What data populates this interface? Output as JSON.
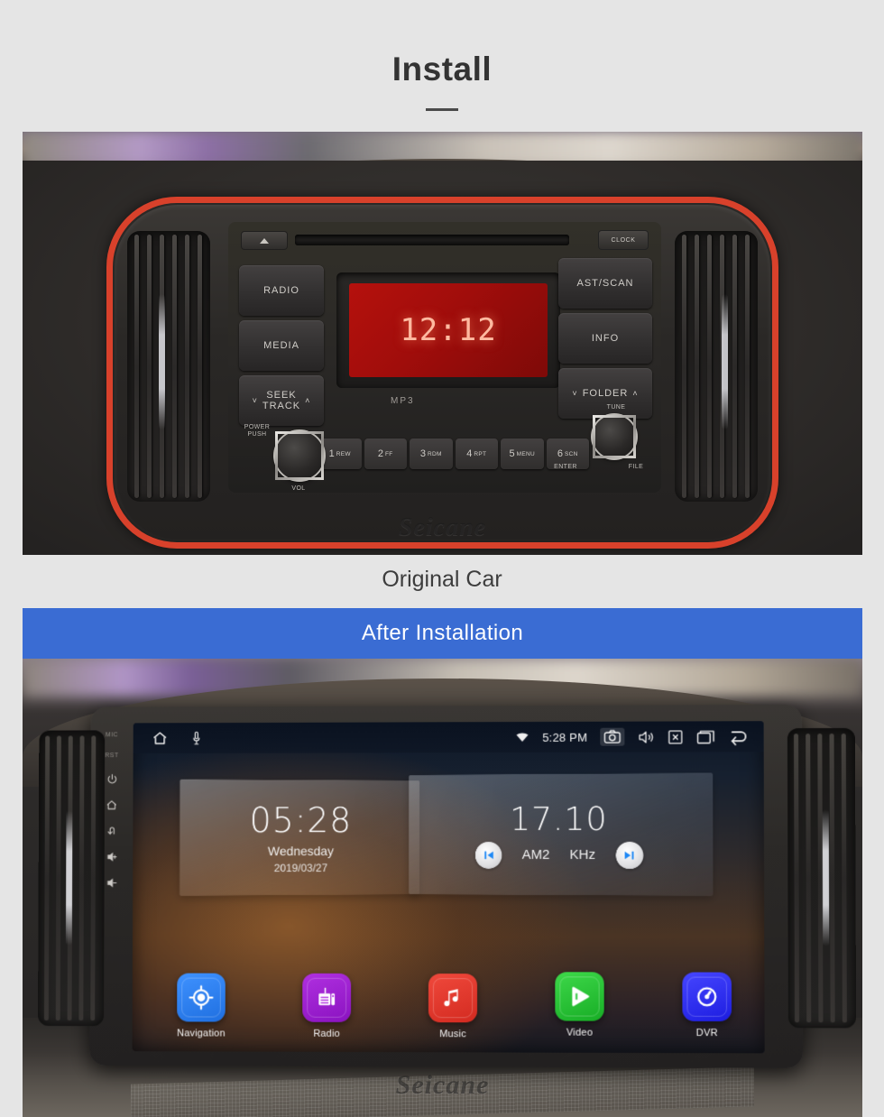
{
  "header": {
    "title": "Install"
  },
  "sections": {
    "original": {
      "caption": "Original Car",
      "watermark": "Seicane",
      "radio": {
        "display_time": "12:12",
        "format_label": "MP3",
        "clock_button": "CLOCK",
        "left_buttons": [
          {
            "label": "RADIO"
          },
          {
            "label": "MEDIA"
          },
          {
            "label_top": "SEEK",
            "label_bottom": "TRACK",
            "arrow_left": "˅",
            "arrow_right": "˄"
          }
        ],
        "right_buttons": [
          {
            "label": "AST/SCAN"
          },
          {
            "label": "INFO"
          },
          {
            "label": "FOLDER",
            "arrow_left": "˅",
            "arrow_right": "˄"
          }
        ],
        "presets": [
          {
            "num": "1",
            "sub": "REW"
          },
          {
            "num": "2",
            "sub": "FF"
          },
          {
            "num": "3",
            "sub": "RDM"
          },
          {
            "num": "4",
            "sub": "RPT"
          },
          {
            "num": "5",
            "sub": "MENU"
          },
          {
            "num": "6",
            "sub": "SCN"
          }
        ],
        "knob_left_top": "POWER\nPUSH",
        "knob_left_bottom": "VOL",
        "knob_right_top": "TUNE",
        "knob_right_bottom": "FILE",
        "enter_label": "ENTER"
      }
    },
    "installed": {
      "banner": "After  Installation",
      "watermark": "Seicane",
      "bezel_buttons": [
        {
          "name": "mic-label",
          "text": "MIC"
        },
        {
          "name": "rst-label",
          "text": "RST"
        },
        {
          "name": "power-icon",
          "text": "⏻"
        },
        {
          "name": "home-icon",
          "text": "⌂"
        },
        {
          "name": "back-icon",
          "text": "↩"
        },
        {
          "name": "volume-up-icon",
          "text": "⟨+"
        },
        {
          "name": "volume-down-icon",
          "text": "⟨−"
        }
      ],
      "status_bar": {
        "time": "5:28 PM",
        "icons": [
          "home-icon",
          "microphone-icon",
          "wifi-icon",
          "screenshot-icon",
          "volume-icon",
          "close-icon",
          "recents-icon",
          "back-icon"
        ]
      },
      "clock_widget": {
        "time": "05:28",
        "weekday": "Wednesday",
        "date": "2019/03/27"
      },
      "radio_widget": {
        "frequency": "17.10",
        "band": "AM2",
        "unit": "KHz",
        "prev_icon": "skip-previous-icon",
        "next_icon": "skip-next-icon"
      },
      "apps": [
        {
          "label": "Navigation",
          "icon": "navigation-target-icon",
          "color": "#2a7cf0"
        },
        {
          "label": "Radio",
          "icon": "radio-receiver-icon",
          "color": "#a020d0"
        },
        {
          "label": "Music",
          "icon": "music-note-icon",
          "color": "#e8372c"
        },
        {
          "label": "Video",
          "icon": "play-button-icon",
          "color": "#2bc43a"
        },
        {
          "label": "DVR",
          "icon": "gauge-icon",
          "color": "#3030e8"
        }
      ]
    }
  },
  "colors": {
    "background": "#e5e5e5",
    "banner_blue": "#3a6cd3",
    "title_text": "#333333",
    "display_red": "#b5110d"
  }
}
